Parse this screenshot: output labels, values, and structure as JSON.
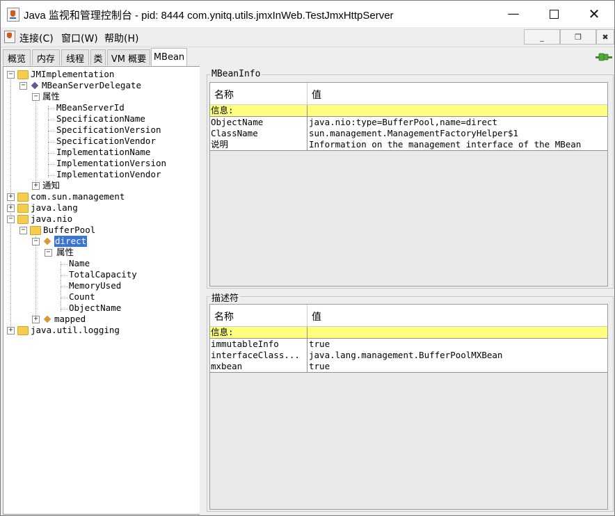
{
  "window": {
    "title": "Java 监视和管理控制台 - pid: 8444 com.ynitq.utils.jmxInWeb.TestJmxHttpServer"
  },
  "menubar": {
    "items": [
      "连接(C)",
      "窗口(W)",
      "帮助(H)"
    ]
  },
  "tabs": [
    "概览",
    "内存",
    "线程",
    "类",
    "VM 概要",
    "MBean"
  ],
  "tree": {
    "nodes": {
      "jmimpl": "JMImplementation",
      "delegate": "MBeanServerDelegate",
      "attr1": "属性",
      "a_id": "MBeanServerId",
      "a_specname": "SpecificationName",
      "a_specver": "SpecificationVersion",
      "a_specvendor": "SpecificationVendor",
      "a_implname": "ImplementationName",
      "a_implver": "ImplementationVersion",
      "a_implvendor": "ImplementationVendor",
      "notify": "通知",
      "sunmgmt": "com.sun.management",
      "javalang": "java.lang",
      "javanio": "java.nio",
      "bufferpool": "BufferPool",
      "direct": "direct",
      "attr2": "属性",
      "b_name": "Name",
      "b_totalcap": "TotalCapacity",
      "b_memused": "MemoryUsed",
      "b_count": "Count",
      "b_objname": "ObjectName",
      "mapped": "mapped",
      "javautillogging": "java.util.logging"
    }
  },
  "mbeaninfo": {
    "title": "MBeanInfo",
    "header": [
      "名称",
      "值"
    ],
    "rows": [
      [
        "信息:",
        ""
      ],
      [
        "ObjectName",
        "java.nio:type=BufferPool,name=direct"
      ],
      [
        "ClassName",
        "sun.management.ManagementFactoryHelper$1"
      ],
      [
        "说明",
        "Information on the management interface of the MBean"
      ]
    ]
  },
  "descriptor": {
    "title": "描述符",
    "header": [
      "名称",
      "值"
    ],
    "rows": [
      [
        "信息:",
        ""
      ],
      [
        "immutableInfo",
        "true"
      ],
      [
        "interfaceClass...",
        "java.lang.management.BufferPoolMXBean"
      ],
      [
        "mxbean",
        "true"
      ]
    ]
  },
  "colors": {
    "selection": "#3875d7",
    "info_row": "#ffff80",
    "folder": "#f5cc4c"
  }
}
